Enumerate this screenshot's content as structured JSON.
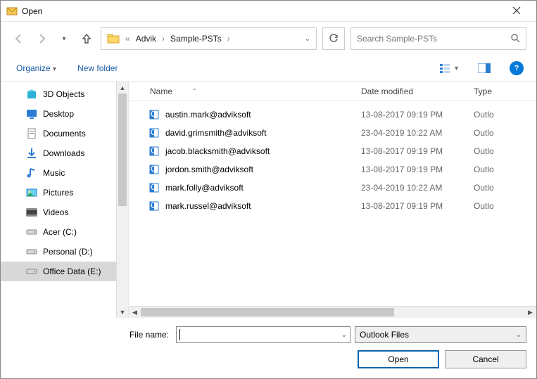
{
  "window": {
    "title": "Open"
  },
  "breadcrumb": {
    "parts": [
      "Advik",
      "Sample-PSTs"
    ]
  },
  "search": {
    "placeholder": "Search Sample-PSTs"
  },
  "toolbar": {
    "organize": "Organize",
    "newfolder": "New folder"
  },
  "tree": {
    "items": [
      {
        "label": "3D Objects"
      },
      {
        "label": "Desktop"
      },
      {
        "label": "Documents"
      },
      {
        "label": "Downloads"
      },
      {
        "label": "Music"
      },
      {
        "label": "Pictures"
      },
      {
        "label": "Videos"
      },
      {
        "label": "Acer (C:)"
      },
      {
        "label": "Personal (D:)"
      },
      {
        "label": "Office Data (E:)"
      }
    ],
    "selectedIndex": 9
  },
  "columns": {
    "name": "Name",
    "date": "Date modified",
    "type": "Type"
  },
  "files": [
    {
      "name": "austin.mark@adviksoft",
      "date": "13-08-2017 09:19 PM",
      "type": "Outlo"
    },
    {
      "name": "david.grimsmith@adviksoft",
      "date": "23-04-2019 10:22 AM",
      "type": "Outlo"
    },
    {
      "name": "jacob.blacksmith@adviksoft",
      "date": "13-08-2017 09:19 PM",
      "type": "Outlo"
    },
    {
      "name": "jordon.smith@adviksoft",
      "date": "13-08-2017 09:19 PM",
      "type": "Outlo"
    },
    {
      "name": "mark.folly@adviksoft",
      "date": "23-04-2019 10:22 AM",
      "type": "Outlo"
    },
    {
      "name": "mark.russel@adviksoft",
      "date": "13-08-2017 09:19 PM",
      "type": "Outlo"
    }
  ],
  "bottom": {
    "filename_label": "File name:",
    "filename_value": "",
    "filter": "Outlook Files",
    "open": "Open",
    "cancel": "Cancel"
  }
}
